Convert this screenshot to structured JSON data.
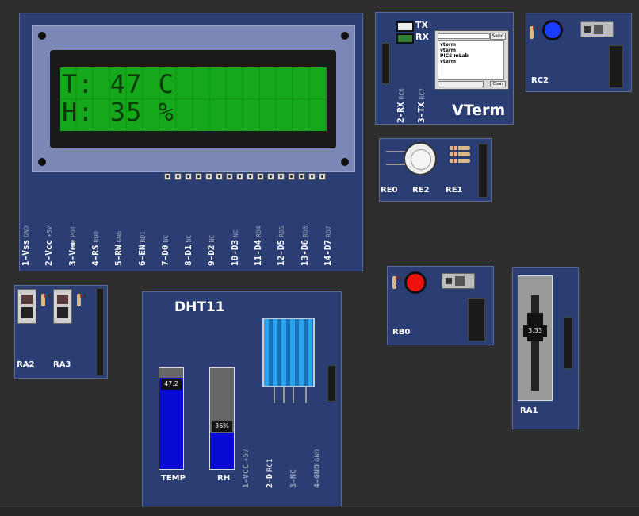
{
  "lcd": {
    "line1": "T: 47 C",
    "line2": "H: 35 %",
    "pins": [
      {
        "name": "1-Vss",
        "sub": "GND"
      },
      {
        "name": "2-Vcc",
        "sub": "+5V"
      },
      {
        "name": "3-Vee",
        "sub": "POT"
      },
      {
        "name": "4-RS",
        "sub": "RD0"
      },
      {
        "name": "5-RW",
        "sub": "GND"
      },
      {
        "name": "6-EN",
        "sub": "RD1"
      },
      {
        "name": "7-D0",
        "sub": "NC"
      },
      {
        "name": "8-D1",
        "sub": "NC"
      },
      {
        "name": "9-D2",
        "sub": "NC"
      },
      {
        "name": "10-D3",
        "sub": "NC"
      },
      {
        "name": "11-D4",
        "sub": "RD4"
      },
      {
        "name": "12-D5",
        "sub": "RD5"
      },
      {
        "name": "13-D6",
        "sub": "RD6"
      },
      {
        "name": "14-D7",
        "sub": "RD7"
      }
    ]
  },
  "vterm": {
    "tx_label": "TX",
    "rx_label": "RX",
    "send_label": "Send",
    "lines": [
      "vterm",
      "vterm",
      "PICSimLab",
      "vterm"
    ],
    "clear_label": "Clear",
    "pin_rx": "2-RX",
    "pin_rx_sub": "RC6",
    "pin_tx": "3-TX",
    "pin_tx_sub": "RC7",
    "title": "VTerm"
  },
  "rc2": {
    "label": "RC2",
    "led_color": "#1a3cff"
  },
  "rgb": {
    "labels": [
      "RE0",
      "RE2",
      "RE1"
    ]
  },
  "switches": {
    "labels": [
      "RA2",
      "RA3"
    ]
  },
  "dht11": {
    "title": "DHT11",
    "temp_value": "47.2",
    "temp_level": 0.9,
    "rh_value": "36%",
    "rh_level": 0.36,
    "temp_label": "TEMP",
    "rh_label": "RH",
    "pins": [
      {
        "name": "1-VCC",
        "sub": "+5V",
        "dim": true
      },
      {
        "name": "2-D",
        "sub": "RC1",
        "dim": false
      },
      {
        "name": "3-NC",
        "sub": "",
        "dim": true
      },
      {
        "name": "4-GND",
        "sub": "GND",
        "dim": true
      }
    ]
  },
  "rb0": {
    "label": "RB0",
    "led_color": "#ee1111"
  },
  "pot": {
    "label": "RA1",
    "value": "3.33",
    "level": 0.67
  },
  "colors": {
    "board": "#2b3e73",
    "lcd": "#14a81a",
    "bar": "#0a0ad6"
  }
}
